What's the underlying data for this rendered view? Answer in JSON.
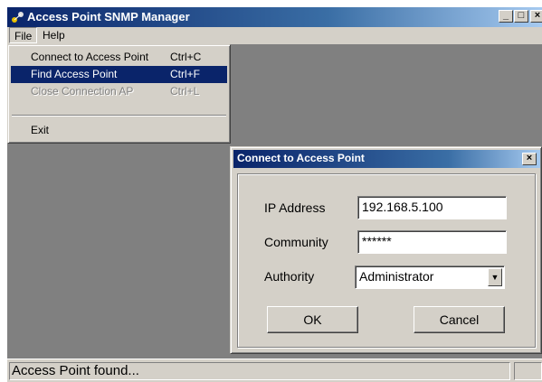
{
  "window": {
    "title": "Access Point SNMP Manager",
    "icon": "network-app-icon",
    "controls": {
      "minimize": "_",
      "maximize": "□",
      "close": "×"
    }
  },
  "menubar": {
    "file": "File",
    "help": "Help"
  },
  "file_menu": {
    "items": [
      {
        "label": "Connect to Access Point",
        "shortcut": "Ctrl+C",
        "state": "normal"
      },
      {
        "label": "Find Access Point",
        "shortcut": "Ctrl+F",
        "state": "highlighted"
      },
      {
        "label": "Close Connection AP",
        "shortcut": "Ctrl+L",
        "state": "disabled"
      },
      {
        "label": "Exit",
        "shortcut": "",
        "state": "normal"
      }
    ]
  },
  "dialog": {
    "title": "Connect to Access Point",
    "close": "×",
    "ip_label": "IP Address",
    "ip_value": "192.168.5.100",
    "community_label": "Community",
    "community_value": "******",
    "authority_label": "Authority",
    "authority_value": "Administrator",
    "ok": "OK",
    "cancel": "Cancel"
  },
  "statusbar": {
    "message": "Access Point found..."
  },
  "colors": {
    "titlebar": "#0a246a",
    "face": "#d4d0c8",
    "client": "#808080",
    "highlight": "#0a246a"
  }
}
